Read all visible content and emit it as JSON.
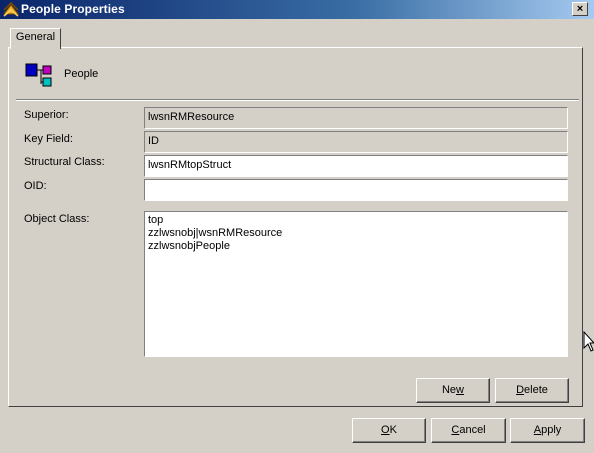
{
  "window": {
    "title": "People Properties",
    "close_label": "×"
  },
  "tabs": [
    {
      "label": "General"
    }
  ],
  "object": {
    "name": "People",
    "icon": "object-class-icon"
  },
  "fields": {
    "superior": {
      "label": "Superior:",
      "value": "lwsnRMResource"
    },
    "key_field": {
      "label": "Key Field:",
      "value": "ID"
    },
    "structural_class": {
      "label": "Structural Class:",
      "value": "lwsnRMtopStruct"
    },
    "oid": {
      "label": "OID:",
      "value": ""
    },
    "object_class": {
      "label": "Object Class:",
      "items": [
        "top",
        "zzlwsnobj|wsnRMResource",
        "zzlwsnobjPeople"
      ]
    }
  },
  "buttons": {
    "new": {
      "pre": "Ne",
      "accel": "w",
      "post": ""
    },
    "delete": {
      "pre": "",
      "accel": "D",
      "post": "elete"
    },
    "ok": {
      "pre": "",
      "accel": "O",
      "post": "K"
    },
    "cancel": {
      "pre": "",
      "accel": "C",
      "post": "ancel"
    },
    "apply": {
      "pre": "",
      "accel": "A",
      "post": "pply"
    }
  },
  "colors": {
    "titlebar_start": "#0a246a",
    "titlebar_end": "#a6caf0",
    "face": "#d4d0c8"
  }
}
